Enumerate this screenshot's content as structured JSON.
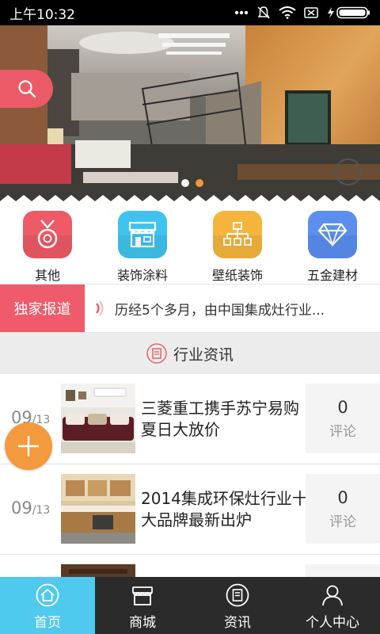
{
  "status_bar": {
    "time": "上午10:32"
  },
  "banner": {
    "slides": 2,
    "active_slide": 2
  },
  "categories": [
    {
      "label": "其他",
      "icon": "medal-icon",
      "color": "#ee5a66"
    },
    {
      "label": "装饰涂料",
      "icon": "storefront-icon",
      "color": "#3fc3ee"
    },
    {
      "label": "壁纸装饰",
      "icon": "network-icon",
      "color": "#f5b53c"
    },
    {
      "label": "五金建材",
      "icon": "diamond-icon",
      "color": "#5a8ff0"
    }
  ],
  "exclusive": {
    "tag": "独家报道",
    "headline": "历经5个多月，由中国集成灶行业..."
  },
  "section": {
    "title": "行业资讯"
  },
  "news": [
    {
      "month": "09",
      "day": "/13",
      "title": "三菱重工携手苏宁易购夏日大放价",
      "comments": "0",
      "comments_label": "评论"
    },
    {
      "month": "09",
      "day": "/13",
      "title": "2014集成环保灶行业十大品牌最新出炉",
      "comments": "0",
      "comments_label": "评论"
    }
  ],
  "tabs": [
    {
      "label": "首页",
      "icon": "home-icon",
      "active": true
    },
    {
      "label": "商城",
      "icon": "shop-icon",
      "active": false
    },
    {
      "label": "资讯",
      "icon": "news-icon",
      "active": false
    },
    {
      "label": "个人中心",
      "icon": "user-icon",
      "active": false
    }
  ]
}
